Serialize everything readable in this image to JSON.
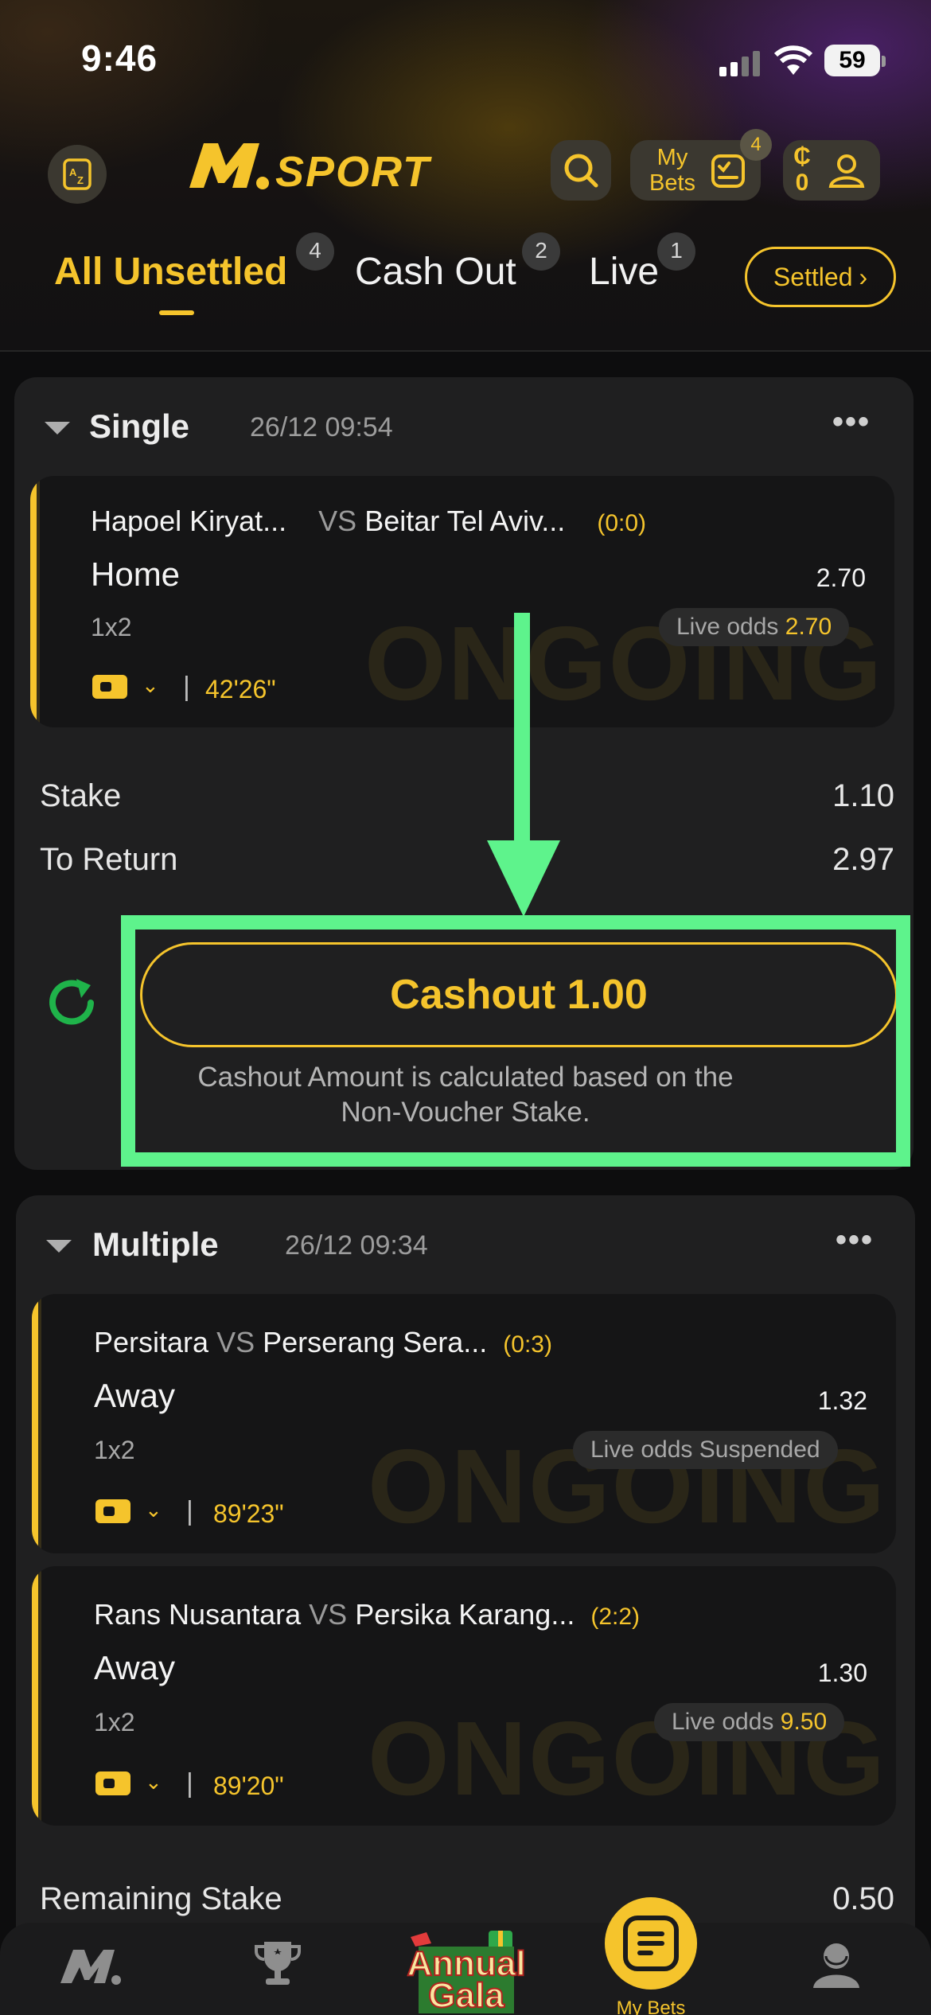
{
  "status_bar": {
    "time": "9:46",
    "battery": "59"
  },
  "header": {
    "brand": "M.SPORT",
    "my_bets_line1": "My",
    "my_bets_line2": "Bets",
    "my_bets_count": "4",
    "wallet_symbol": "₵",
    "wallet_amount": "0"
  },
  "tabs": [
    {
      "label": "All Unsettled",
      "count": "4",
      "active": true
    },
    {
      "label": "Cash Out",
      "count": "2"
    },
    {
      "label": "Live",
      "count": "1"
    }
  ],
  "settled_label": "Settled",
  "single": {
    "title": "Single",
    "date": "26/12 09:54",
    "leg": {
      "home": "Hapoel Kiryat...",
      "vs": "VS",
      "away": "Beitar Tel Aviv...",
      "score": "(0:0)",
      "pick": "Home",
      "odds": "2.70",
      "market": "1x2",
      "live_odds_label": "Live odds",
      "live_odds_value": "2.70",
      "status": "ONGOING",
      "match_time": "42'26\""
    },
    "stake_label": "Stake",
    "stake_value": "1.10",
    "return_label": "To Return",
    "return_value": "2.97",
    "cashout_label": "Cashout 1.00",
    "cashout_note_line1": "Cashout Amount is calculated based on the",
    "cashout_note_line2": "Non-Voucher Stake."
  },
  "multiple": {
    "title": "Multiple",
    "date": "26/12 09:34",
    "legs": [
      {
        "home": "Persitara",
        "vs": "VS",
        "away": "Perserang Sera...",
        "score": "(0:3)",
        "pick": "Away",
        "odds": "1.32",
        "market": "1x2",
        "live_odds_text": "Live odds Suspended",
        "status": "ONGOING",
        "match_time": "89'23\""
      },
      {
        "home": "Rans Nusantara",
        "vs": "VS",
        "away": "Persika Karang...",
        "score": "(2:2)",
        "pick": "Away",
        "odds": "1.30",
        "market": "1x2",
        "live_odds_label": "Live odds",
        "live_odds_value": "9.50",
        "status": "ONGOING",
        "match_time": "89'20\""
      }
    ],
    "remaining_stake_label": "Remaining Stake",
    "remaining_stake_value": "0.50"
  },
  "bottom_nav": {
    "gala_line1": "Annual",
    "gala_line2": "Gala",
    "center_label": "My Bets"
  },
  "colors": {
    "accent": "#f5c42c",
    "highlight": "#5ef38c",
    "refresh": "#1fb34a",
    "card": "#1f1f20"
  }
}
